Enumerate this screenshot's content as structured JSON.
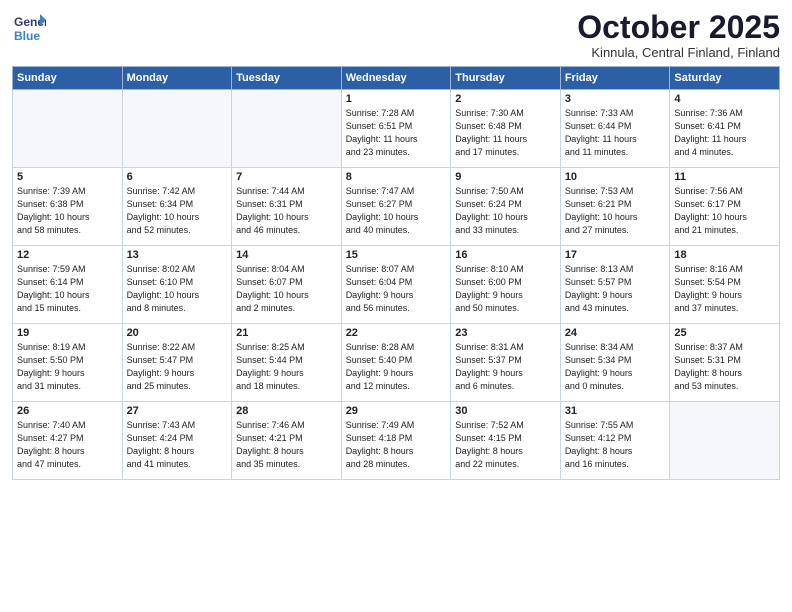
{
  "header": {
    "logo": {
      "general": "General",
      "blue": "Blue"
    },
    "month": "October 2025",
    "location": "Kinnula, Central Finland, Finland"
  },
  "weekdays": [
    "Sunday",
    "Monday",
    "Tuesday",
    "Wednesday",
    "Thursday",
    "Friday",
    "Saturday"
  ],
  "weeks": [
    [
      {
        "day": "",
        "info": ""
      },
      {
        "day": "",
        "info": ""
      },
      {
        "day": "",
        "info": ""
      },
      {
        "day": "1",
        "info": "Sunrise: 7:28 AM\nSunset: 6:51 PM\nDaylight: 11 hours\nand 23 minutes."
      },
      {
        "day": "2",
        "info": "Sunrise: 7:30 AM\nSunset: 6:48 PM\nDaylight: 11 hours\nand 17 minutes."
      },
      {
        "day": "3",
        "info": "Sunrise: 7:33 AM\nSunset: 6:44 PM\nDaylight: 11 hours\nand 11 minutes."
      },
      {
        "day": "4",
        "info": "Sunrise: 7:36 AM\nSunset: 6:41 PM\nDaylight: 11 hours\nand 4 minutes."
      }
    ],
    [
      {
        "day": "5",
        "info": "Sunrise: 7:39 AM\nSunset: 6:38 PM\nDaylight: 10 hours\nand 58 minutes."
      },
      {
        "day": "6",
        "info": "Sunrise: 7:42 AM\nSunset: 6:34 PM\nDaylight: 10 hours\nand 52 minutes."
      },
      {
        "day": "7",
        "info": "Sunrise: 7:44 AM\nSunset: 6:31 PM\nDaylight: 10 hours\nand 46 minutes."
      },
      {
        "day": "8",
        "info": "Sunrise: 7:47 AM\nSunset: 6:27 PM\nDaylight: 10 hours\nand 40 minutes."
      },
      {
        "day": "9",
        "info": "Sunrise: 7:50 AM\nSunset: 6:24 PM\nDaylight: 10 hours\nand 33 minutes."
      },
      {
        "day": "10",
        "info": "Sunrise: 7:53 AM\nSunset: 6:21 PM\nDaylight: 10 hours\nand 27 minutes."
      },
      {
        "day": "11",
        "info": "Sunrise: 7:56 AM\nSunset: 6:17 PM\nDaylight: 10 hours\nand 21 minutes."
      }
    ],
    [
      {
        "day": "12",
        "info": "Sunrise: 7:59 AM\nSunset: 6:14 PM\nDaylight: 10 hours\nand 15 minutes."
      },
      {
        "day": "13",
        "info": "Sunrise: 8:02 AM\nSunset: 6:10 PM\nDaylight: 10 hours\nand 8 minutes."
      },
      {
        "day": "14",
        "info": "Sunrise: 8:04 AM\nSunset: 6:07 PM\nDaylight: 10 hours\nand 2 minutes."
      },
      {
        "day": "15",
        "info": "Sunrise: 8:07 AM\nSunset: 6:04 PM\nDaylight: 9 hours\nand 56 minutes."
      },
      {
        "day": "16",
        "info": "Sunrise: 8:10 AM\nSunset: 6:00 PM\nDaylight: 9 hours\nand 50 minutes."
      },
      {
        "day": "17",
        "info": "Sunrise: 8:13 AM\nSunset: 5:57 PM\nDaylight: 9 hours\nand 43 minutes."
      },
      {
        "day": "18",
        "info": "Sunrise: 8:16 AM\nSunset: 5:54 PM\nDaylight: 9 hours\nand 37 minutes."
      }
    ],
    [
      {
        "day": "19",
        "info": "Sunrise: 8:19 AM\nSunset: 5:50 PM\nDaylight: 9 hours\nand 31 minutes."
      },
      {
        "day": "20",
        "info": "Sunrise: 8:22 AM\nSunset: 5:47 PM\nDaylight: 9 hours\nand 25 minutes."
      },
      {
        "day": "21",
        "info": "Sunrise: 8:25 AM\nSunset: 5:44 PM\nDaylight: 9 hours\nand 18 minutes."
      },
      {
        "day": "22",
        "info": "Sunrise: 8:28 AM\nSunset: 5:40 PM\nDaylight: 9 hours\nand 12 minutes."
      },
      {
        "day": "23",
        "info": "Sunrise: 8:31 AM\nSunset: 5:37 PM\nDaylight: 9 hours\nand 6 minutes."
      },
      {
        "day": "24",
        "info": "Sunrise: 8:34 AM\nSunset: 5:34 PM\nDaylight: 9 hours\nand 0 minutes."
      },
      {
        "day": "25",
        "info": "Sunrise: 8:37 AM\nSunset: 5:31 PM\nDaylight: 8 hours\nand 53 minutes."
      }
    ],
    [
      {
        "day": "26",
        "info": "Sunrise: 7:40 AM\nSunset: 4:27 PM\nDaylight: 8 hours\nand 47 minutes."
      },
      {
        "day": "27",
        "info": "Sunrise: 7:43 AM\nSunset: 4:24 PM\nDaylight: 8 hours\nand 41 minutes."
      },
      {
        "day": "28",
        "info": "Sunrise: 7:46 AM\nSunset: 4:21 PM\nDaylight: 8 hours\nand 35 minutes."
      },
      {
        "day": "29",
        "info": "Sunrise: 7:49 AM\nSunset: 4:18 PM\nDaylight: 8 hours\nand 28 minutes."
      },
      {
        "day": "30",
        "info": "Sunrise: 7:52 AM\nSunset: 4:15 PM\nDaylight: 8 hours\nand 22 minutes."
      },
      {
        "day": "31",
        "info": "Sunrise: 7:55 AM\nSunset: 4:12 PM\nDaylight: 8 hours\nand 16 minutes."
      },
      {
        "day": "",
        "info": ""
      }
    ]
  ]
}
